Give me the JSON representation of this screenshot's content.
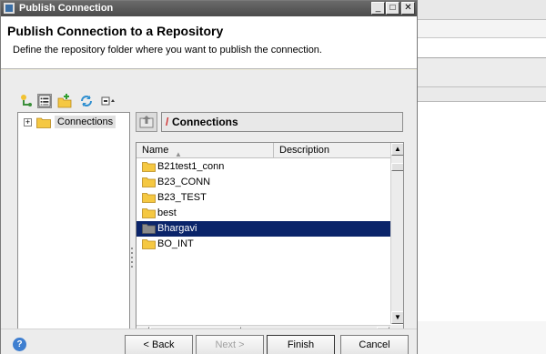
{
  "window": {
    "title": "Publish Connection",
    "controls": {
      "minimize": "_",
      "maximize": "□",
      "close": "✕"
    }
  },
  "header": {
    "title": "Publish Connection to a Repository",
    "description": "Define the repository folder where you want to publish the connection."
  },
  "tree_toolbar": {
    "icons": [
      "hierarchy-icon",
      "list-view-icon",
      "new-folder-icon",
      "refresh-icon",
      "collapse-icon"
    ]
  },
  "tree": {
    "items": [
      {
        "label": "Connections",
        "expander": "+"
      }
    ]
  },
  "path_bar": {
    "separator": "/",
    "path": "Connections"
  },
  "list": {
    "columns": [
      "Name",
      "Description"
    ],
    "rows": [
      {
        "name": "B21test1_conn",
        "description": ""
      },
      {
        "name": "B23_CONN",
        "description": ""
      },
      {
        "name": "B23_TEST",
        "description": ""
      },
      {
        "name": "best",
        "description": ""
      },
      {
        "name": "Bhargavi",
        "description": "",
        "selected": true
      },
      {
        "name": "BO_INT",
        "description": ""
      }
    ],
    "selected_row_color": "#0a246a"
  },
  "footer": {
    "help": "?",
    "back": "< Back",
    "next": "Next >",
    "finish": "Finish",
    "cancel": "Cancel"
  },
  "colors": {
    "titlebar": "#4b4b4b",
    "folder": "#f5c842",
    "path_slash": "#d03030"
  }
}
